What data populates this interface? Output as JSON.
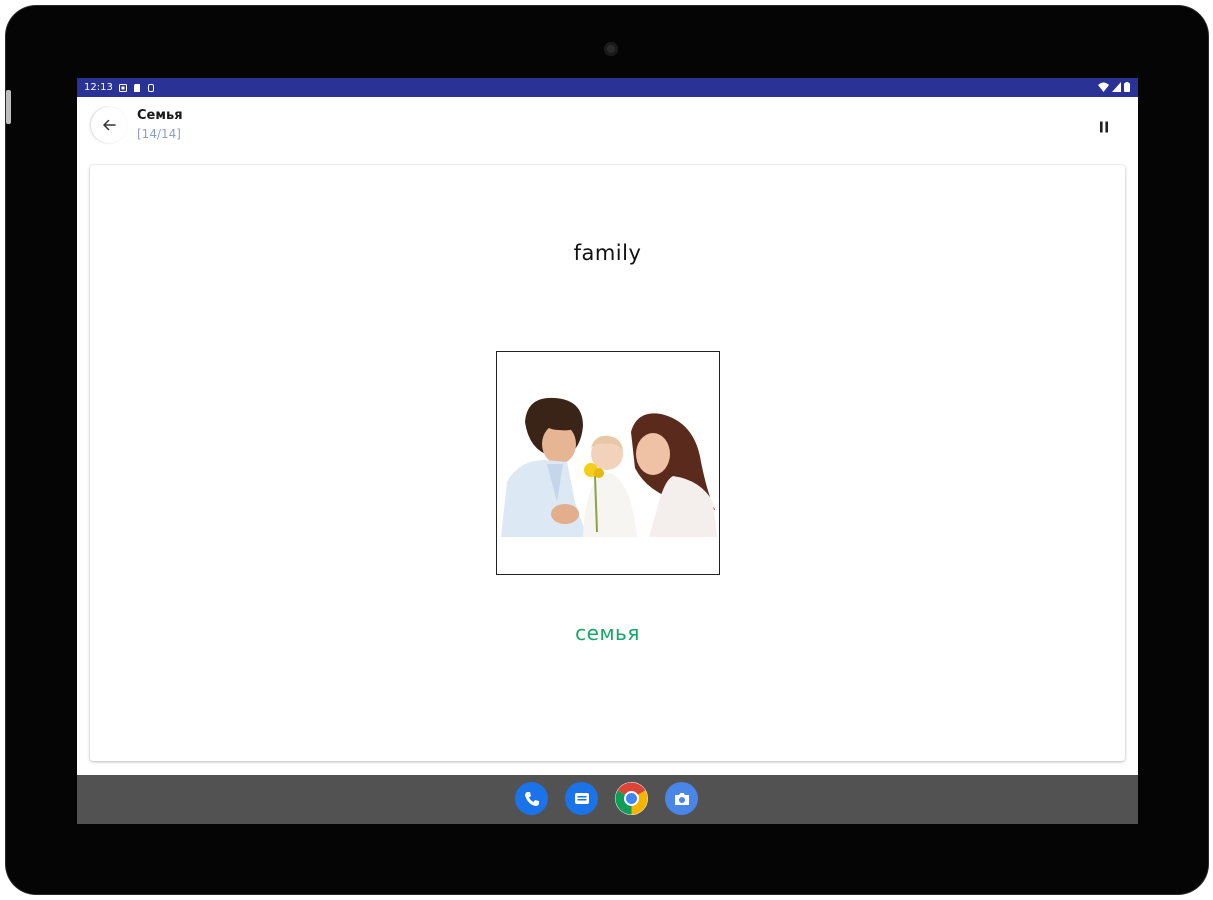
{
  "status_bar": {
    "time": "12:13"
  },
  "app_bar": {
    "title": "Семья",
    "progress": "[14/14]"
  },
  "card": {
    "word": "family",
    "translation": "семья"
  },
  "colors": {
    "status_bar": "#2a3296",
    "progress_text": "#8fa0c8",
    "translation_text": "#15a86a",
    "nav_bar": "#525252",
    "phone_app": "#1a73e8",
    "messages_app": "#1a73e8",
    "camera_app": "#4a86e8"
  },
  "icons": {
    "back": "arrow-left-icon",
    "pause": "pause-icon",
    "dock": [
      "phone-icon",
      "messages-icon",
      "chrome-icon",
      "camera-icon"
    ]
  }
}
